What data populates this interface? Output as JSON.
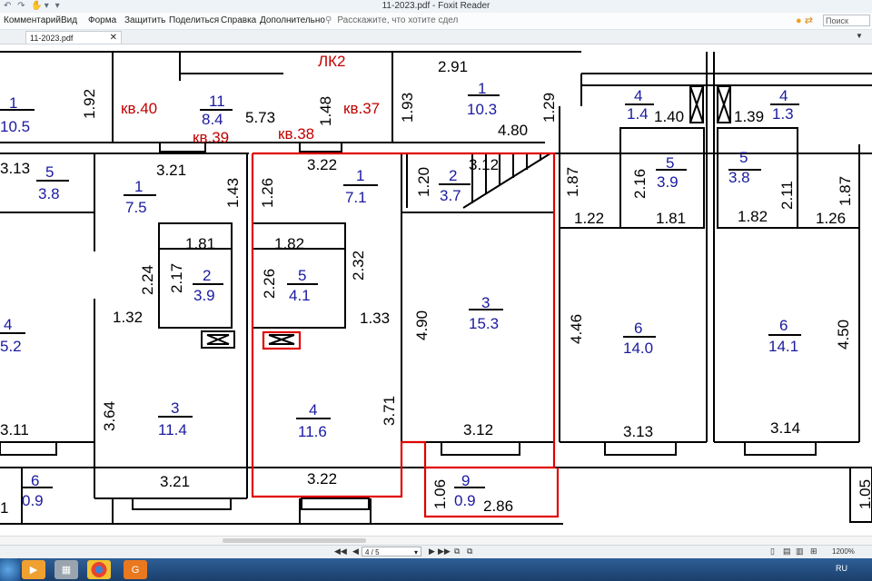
{
  "window": {
    "title": "11-2023.pdf - Foxit Reader",
    "quick_access": "↶ ↷ ✋▾ ▾"
  },
  "menu": {
    "items": [
      "Комментарий",
      "Вид",
      "Форма",
      "Защитить",
      "Поделиться",
      "Справка",
      "Дополнительно"
    ],
    "tell_me": "Расскажите, что хотите сдел",
    "search_placeholder": "Поиск"
  },
  "tabs": [
    {
      "label": "11-2023.pdf"
    }
  ],
  "status": {
    "page": "4 / 5",
    "zoom": "1200%",
    "nav_first": "◀◀",
    "nav_prev": "◀",
    "nav_next": "▶",
    "nav_last": "▶▶"
  },
  "taskbar": {
    "language": "RU"
  },
  "plan": {
    "labels": {
      "lk2": "ЛК2",
      "apt40": "кв.40",
      "apt39": "кв.39",
      "apt38": "кв.38",
      "apt37": "кв.37",
      "d291": "2.91",
      "d192": "1.92",
      "d573": "5.73",
      "d148": "1.48",
      "d193": "1.93",
      "d480": "4.80",
      "d129": "1.29",
      "d140": "1.40",
      "d139": "1.39",
      "d313a": "3.13",
      "d321a": "3.21",
      "d143": "1.43",
      "d126": "1.26",
      "d322a": "3.22",
      "d120": "1.20",
      "d312a": "3.12",
      "d187a": "1.87",
      "d216": "2.16",
      "d211": "2.11",
      "d187b": "1.87",
      "d122": "1.22",
      "d181a": "1.81",
      "d182a": "1.82",
      "d126b": "1.26",
      "d181b": "1.81",
      "d182b": "1.82",
      "d224": "2.24",
      "d217": "2.17",
      "d226": "2.26",
      "d232": "2.32",
      "d132": "1.32",
      "d133": "1.33",
      "d490": "4.90",
      "d446": "4.46",
      "d450": "4.50",
      "d364": "3.64",
      "d371": "3.71",
      "d311": "3.11",
      "d312b": "3.12",
      "d313b": "3.13",
      "d314": "3.14",
      "d321b": "3.21",
      "d322b": "3.22",
      "d106": "1.06",
      "d286": "2.86",
      "d105": "1.05",
      "d1": "1"
    },
    "rooms": [
      {
        "num": "1",
        "area": "10.5"
      },
      {
        "num": "11",
        "area": "8.4"
      },
      {
        "num": "1",
        "area": "10.3"
      },
      {
        "num": "4",
        "area": "1.4"
      },
      {
        "num": "4",
        "area": "1.3"
      },
      {
        "num": "5",
        "area": "3.8"
      },
      {
        "num": "1",
        "area": "7.5"
      },
      {
        "num": "1",
        "area": "7.1"
      },
      {
        "num": "2",
        "area": "3.7"
      },
      {
        "num": "5",
        "area": "3.9"
      },
      {
        "num": "5",
        "area": "3.8"
      },
      {
        "num": "2",
        "area": "3.9"
      },
      {
        "num": "5",
        "area": "4.1"
      },
      {
        "num": "3",
        "area": "15.3"
      },
      {
        "num": "4",
        "area": "5.2"
      },
      {
        "num": "6",
        "area": "14.0"
      },
      {
        "num": "6",
        "area": "14.1"
      },
      {
        "num": "3",
        "area": "11.4"
      },
      {
        "num": "4",
        "area": "11.6"
      },
      {
        "num": "6",
        "area": "0.9"
      },
      {
        "num": "9",
        "area": "0.9"
      }
    ]
  }
}
